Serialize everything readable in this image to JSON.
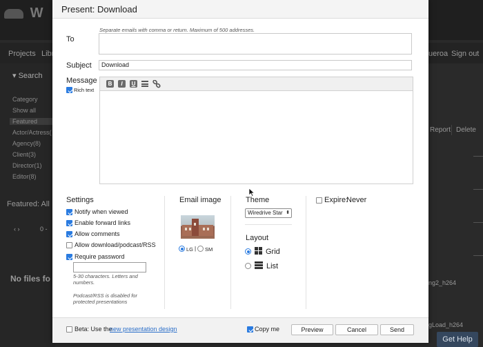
{
  "background": {
    "logo": "W",
    "nav": [
      "Projects",
      "Libr"
    ],
    "nav_right": [
      "ueroa",
      "Sign out"
    ],
    "search_label": "Search",
    "category_label": "Category",
    "categories": [
      "Show all",
      "Featured",
      "Actor/Actress(",
      "Agency(8)",
      "Client(3)",
      "Director(1)",
      "Editor(8)"
    ],
    "featured_heading": "Featured: All",
    "pager": "0 -",
    "no_files": "No files fo",
    "report_btn": "Report",
    "delete_btn": "Delete",
    "file_1": "ng2_h264",
    "file_2": "gLoad_h264",
    "help_btn": "Get Help"
  },
  "modal": {
    "title": "Present: Download",
    "to_label": "To",
    "to_hint": "Separate emails with comma or return. Maximum of 500 addresses.",
    "to_value": "",
    "subject_label": "Subject",
    "subject_value": "Download",
    "message_label": "Message",
    "rich_text_label": "Rich text",
    "toolbar": {
      "bold": "B",
      "italic": "I",
      "underline": "U",
      "list_icon": "list-icon",
      "link_icon": "link-icon"
    },
    "settings": {
      "heading": "Settings",
      "options": [
        {
          "label": "Notify when viewed",
          "checked": true
        },
        {
          "label": "Enable forward links",
          "checked": true
        },
        {
          "label": "Allow comments",
          "checked": true
        },
        {
          "label": "Allow download/podcast/RSS",
          "checked": false
        },
        {
          "label": "Require password",
          "checked": true
        }
      ],
      "password_value": "",
      "password_hint": "5-30 characters. Letters and numbers.",
      "podcast_hint": "Podcast/RSS is disabled for protected presentations"
    },
    "email_image": {
      "heading": "Email image",
      "size_lg": "LG",
      "separator": "|",
      "size_sm": "SM",
      "selected": "LG"
    },
    "theme": {
      "heading": "Theme",
      "selected": "Wiredrive Star",
      "layout_heading": "Layout",
      "layout_grid": "Grid",
      "layout_list": "List",
      "layout_selected": "Grid"
    },
    "expire": {
      "label": "Expire:",
      "value": "Never",
      "checked": false
    },
    "footer": {
      "beta_prefix": "Beta: Use the",
      "beta_link": "new presentation design",
      "copy_me": "Copy me",
      "copy_me_checked": true,
      "preview": "Preview",
      "cancel": "Cancel",
      "send": "Send"
    },
    "accent_color": "#2a7be0"
  }
}
